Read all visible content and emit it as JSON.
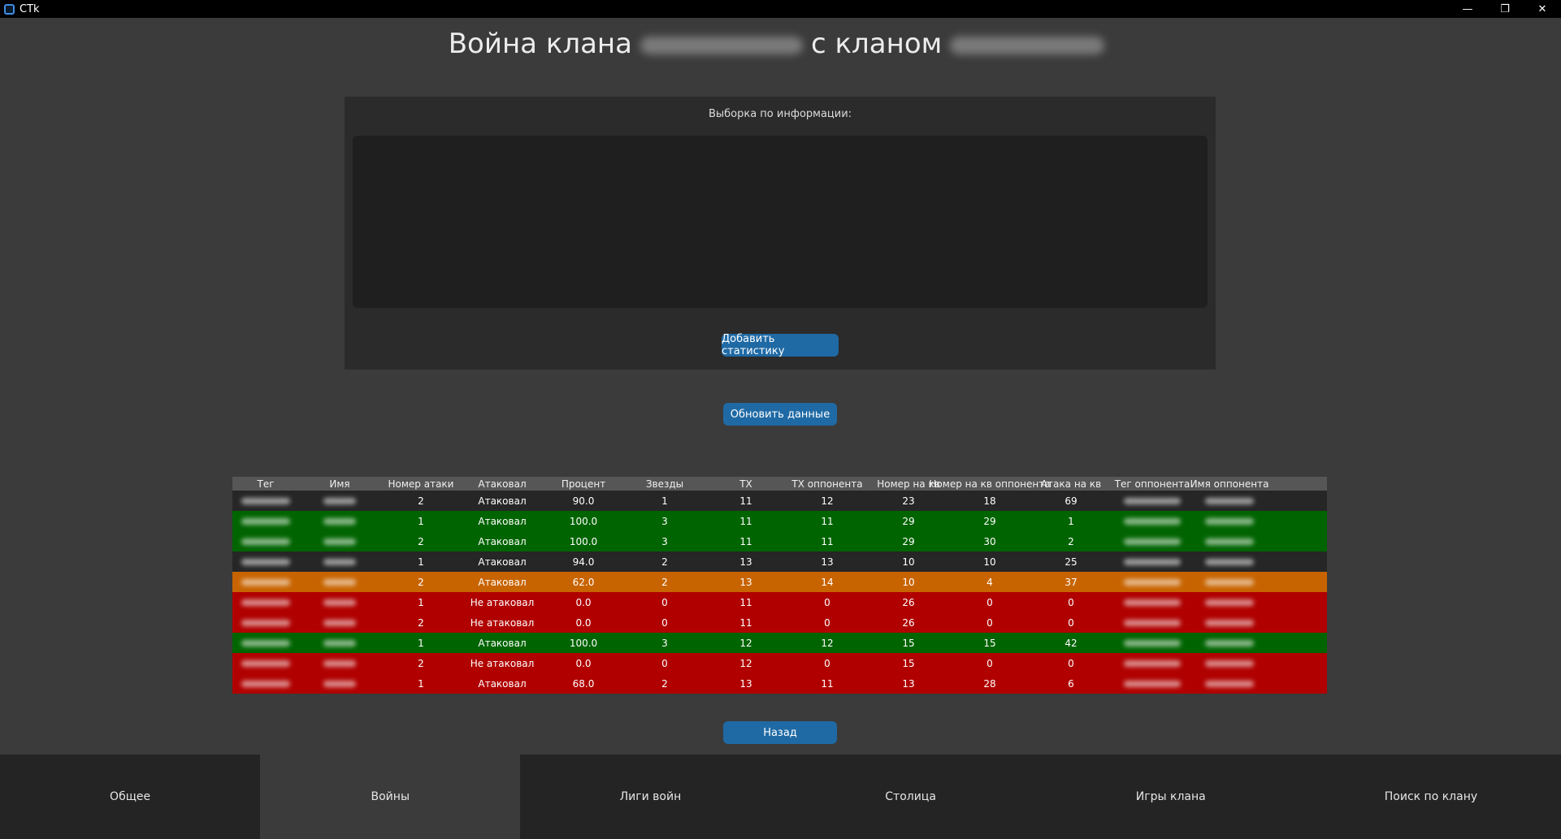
{
  "window": {
    "title": "CTk",
    "controls": {
      "minimize": "—",
      "maximize": "❐",
      "close": "✕"
    }
  },
  "header": {
    "title_prefix": "Война клана",
    "title_middle": "с кланом"
  },
  "info": {
    "label": "Выборка по информации:",
    "text": "",
    "add_button": "Добавить статистику"
  },
  "refresh_button": "Обновить данные",
  "table": {
    "columns": [
      "Тег",
      "Имя",
      "Номер атаки",
      "Атаковал",
      "Процент",
      "Звезды",
      "TX",
      "TX оппонента",
      "Номер на кв",
      "Номер на кв оппонента",
      "Атака на кв",
      "Тег оппонента",
      "Имя оппонента"
    ],
    "rows": [
      {
        "status": "dark",
        "attack_no": "2",
        "attacked": "Атаковал",
        "percent": "90.0",
        "stars": "1",
        "th": "11",
        "opp_th": "12",
        "war_pos": "23",
        "opp_war_pos": "18",
        "war_attack": "69"
      },
      {
        "status": "green",
        "attack_no": "1",
        "attacked": "Атаковал",
        "percent": "100.0",
        "stars": "3",
        "th": "11",
        "opp_th": "11",
        "war_pos": "29",
        "opp_war_pos": "29",
        "war_attack": "1"
      },
      {
        "status": "green",
        "attack_no": "2",
        "attacked": "Атаковал",
        "percent": "100.0",
        "stars": "3",
        "th": "11",
        "opp_th": "11",
        "war_pos": "29",
        "opp_war_pos": "30",
        "war_attack": "2"
      },
      {
        "status": "dark",
        "attack_no": "1",
        "attacked": "Атаковал",
        "percent": "94.0",
        "stars": "2",
        "th": "13",
        "opp_th": "13",
        "war_pos": "10",
        "opp_war_pos": "10",
        "war_attack": "25"
      },
      {
        "status": "orange",
        "attack_no": "2",
        "attacked": "Атаковал",
        "percent": "62.0",
        "stars": "2",
        "th": "13",
        "opp_th": "14",
        "war_pos": "10",
        "opp_war_pos": "4",
        "war_attack": "37"
      },
      {
        "status": "red",
        "attack_no": "1",
        "attacked": "Не атаковал",
        "percent": "0.0",
        "stars": "0",
        "th": "11",
        "opp_th": "0",
        "war_pos": "26",
        "opp_war_pos": "0",
        "war_attack": "0"
      },
      {
        "status": "red",
        "attack_no": "2",
        "attacked": "Не атаковал",
        "percent": "0.0",
        "stars": "0",
        "th": "11",
        "opp_th": "0",
        "war_pos": "26",
        "opp_war_pos": "0",
        "war_attack": "0"
      },
      {
        "status": "green",
        "attack_no": "1",
        "attacked": "Атаковал",
        "percent": "100.0",
        "stars": "3",
        "th": "12",
        "opp_th": "12",
        "war_pos": "15",
        "opp_war_pos": "15",
        "war_attack": "42"
      },
      {
        "status": "red",
        "attack_no": "2",
        "attacked": "Не атаковал",
        "percent": "0.0",
        "stars": "0",
        "th": "12",
        "opp_th": "0",
        "war_pos": "15",
        "opp_war_pos": "0",
        "war_attack": "0"
      },
      {
        "status": "red",
        "attack_no": "1",
        "attacked": "Атаковал",
        "percent": "68.0",
        "stars": "2",
        "th": "13",
        "opp_th": "11",
        "war_pos": "13",
        "opp_war_pos": "28",
        "war_attack": "6"
      }
    ]
  },
  "back_button": "Назад",
  "tabs": [
    {
      "label": "Общее",
      "active": false
    },
    {
      "label": "Войны",
      "active": true
    },
    {
      "label": "Лиги войн",
      "active": false
    },
    {
      "label": "Столица",
      "active": false
    },
    {
      "label": "Игры клана",
      "active": false
    },
    {
      "label": "Поиск по клану",
      "active": false
    }
  ],
  "colors": {
    "dark": "#262626",
    "green": "#006400",
    "orange": "#c86400",
    "red": "#b00000",
    "button": "#1f6aa5"
  }
}
